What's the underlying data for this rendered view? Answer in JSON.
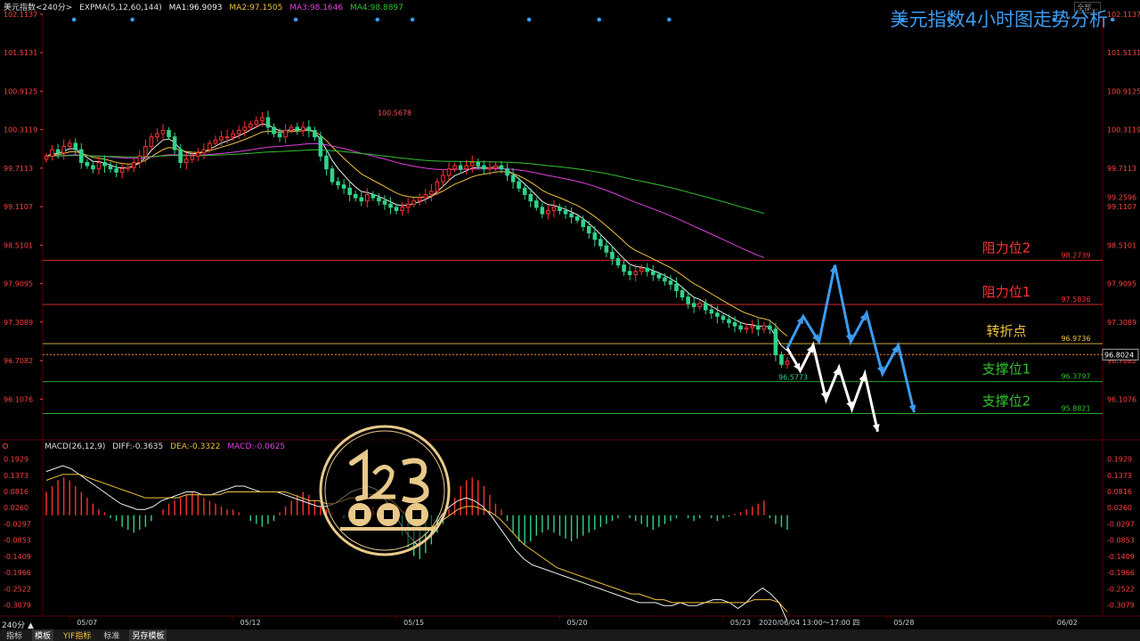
{
  "header": {
    "symbol": "美元指数<240分>",
    "indicator": "EXPMA(5,12,60,144)",
    "ma1": "MA1:96.9093",
    "ma2": "MA2:97.1505",
    "ma3": "MA3:98.1646",
    "ma4": "MA4:98.8897"
  },
  "title": "美元指数4小时图走势分析",
  "top_right_label": "全部...",
  "macd_header": {
    "name": "MACD(26,12,9)",
    "diff": "DIFF:-0.3635",
    "dea": "DEA:-0.3322",
    "macd": "MACD:-0.0625"
  },
  "period_label": "240分 ▲",
  "date_info": "2020/06/04 13:00～17:00 四",
  "bottom_tabs": [
    "指标",
    "模板",
    "YIF指标",
    "标准",
    "另存模板"
  ],
  "colors": {
    "up": "#ff3030",
    "down": "#2fd38a",
    "ma1": "#f0f0f0",
    "ma2": "#f0c040",
    "ma3": "#e040e0",
    "ma4": "#30c030",
    "blue": "#3b9cf0",
    "resist": "#ff3030",
    "turn": "#f0c040",
    "support": "#30c030",
    "grid": "#330000"
  },
  "chart_data": [
    {
      "type": "line",
      "name": "candlestick",
      "yticks": [
        "102.1137",
        "101.5131",
        "100.9125",
        "100.3119",
        "99.7113",
        "99.1107",
        "98.5101",
        "97.9095",
        "97.3089",
        "96.7082",
        "96.1076"
      ],
      "ylim": [
        95.5,
        102.1137
      ],
      "xticks": [
        {
          "label": "05/07",
          "i": 4
        },
        {
          "label": "05/12",
          "i": 32
        },
        {
          "label": "05/15",
          "i": 60
        },
        {
          "label": "05/20",
          "i": 88
        },
        {
          "label": "05/23",
          "i": 116
        },
        {
          "label": "05/28",
          "i": 144
        },
        {
          "label": "06/02",
          "i": 172
        }
      ],
      "high_label": {
        "text": "100.5678",
        "i": 58,
        "value": 100.5678
      },
      "low_label": {
        "text": "96.5773",
        "i": 206,
        "value": 96.5773
      },
      "current_price": "96.8024",
      "current_value": 96.8024,
      "levels": [
        {
          "name": "阻力位2",
          "value": 98.2739,
          "label": "98.2739",
          "kind": "resist"
        },
        {
          "name": "阻力位1",
          "value": 97.5836,
          "label": "97.5836",
          "kind": "resist"
        },
        {
          "name": "转折点",
          "value": 96.9736,
          "label": "96.9736",
          "kind": "turn"
        },
        {
          "name": "支撑位1",
          "value": 96.3797,
          "label": "96.3797",
          "kind": "support"
        },
        {
          "name": "支撑位2",
          "value": 95.8821,
          "label": "95.8821",
          "kind": "support"
        }
      ],
      "right_side_label": {
        "text": "99.2596",
        "value": 99.2596
      },
      "closes": [
        99.9,
        100.0,
        99.95,
        100.05,
        100.1,
        100.0,
        99.8,
        99.75,
        99.7,
        99.8,
        99.75,
        99.7,
        99.65,
        99.7,
        99.72,
        99.8,
        99.9,
        100.05,
        100.2,
        100.25,
        100.3,
        100.2,
        100.0,
        99.8,
        99.85,
        99.9,
        99.95,
        100.0,
        100.1,
        100.15,
        100.2,
        100.2,
        100.25,
        100.3,
        100.35,
        100.4,
        100.45,
        100.5,
        100.35,
        100.25,
        100.2,
        100.3,
        100.35,
        100.3,
        100.35,
        100.3,
        100.2,
        99.9,
        99.7,
        99.5,
        99.45,
        99.4,
        99.3,
        99.25,
        99.2,
        99.3,
        99.25,
        99.2,
        99.15,
        99.1,
        99.05,
        99.1,
        99.15,
        99.2,
        99.25,
        99.3,
        99.35,
        99.5,
        99.6,
        99.7,
        99.75,
        99.7,
        99.75,
        99.8,
        99.75,
        99.7,
        99.72,
        99.75,
        99.7,
        99.6,
        99.5,
        99.4,
        99.3,
        99.2,
        99.1,
        99.0,
        99.05,
        99.1,
        99.05,
        99.0,
        98.95,
        98.9,
        98.8,
        98.7,
        98.6,
        98.5,
        98.4,
        98.3,
        98.2,
        98.1,
        98.05,
        98.1,
        98.15,
        98.1,
        98.05,
        98.0,
        97.95,
        97.9,
        97.8,
        97.7,
        97.6,
        97.55,
        97.6,
        97.5,
        97.45,
        97.4,
        97.35,
        97.3,
        97.25,
        97.2,
        97.22,
        97.25,
        97.2,
        97.25,
        97.2,
        96.8,
        96.65,
        96.7
      ],
      "series_ma": [
        {
          "name": "MA1",
          "values_from": "closes",
          "period": 5
        },
        {
          "name": "MA2",
          "values_from": "closes",
          "period": 12
        },
        {
          "name": "MA3",
          "values_from": "closes",
          "period": 60
        },
        {
          "name": "MA4",
          "values_from": "closes",
          "period": 144
        }
      ],
      "projection_blue": [
        [
          96.9,
          0
        ],
        [
          97.4,
          1
        ],
        [
          97.0,
          2
        ],
        [
          98.2,
          3
        ],
        [
          97.0,
          4
        ],
        [
          97.45,
          5
        ],
        [
          96.5,
          6
        ],
        [
          96.95,
          7
        ],
        [
          95.9,
          8
        ]
      ],
      "projection_white": [
        [
          96.9,
          0
        ],
        [
          96.55,
          1
        ],
        [
          96.95,
          2
        ],
        [
          96.1,
          3
        ],
        [
          96.6,
          4
        ],
        [
          95.95,
          5
        ],
        [
          96.5,
          6
        ],
        [
          95.6,
          7
        ]
      ]
    },
    {
      "type": "bar",
      "name": "MACD",
      "yticks": [
        "0.1929",
        "0.1373",
        "0.0816",
        "0.0260",
        "-0.0297",
        "-0.0853",
        "-0.1409",
        "-0.1966",
        "-0.2522",
        "-0.3079"
      ],
      "ylim": [
        -0.34,
        0.21
      ],
      "histogram": [
        0.08,
        0.1,
        0.12,
        0.13,
        0.12,
        0.1,
        0.08,
        0.06,
        0.04,
        0.02,
        0.01,
        -0.01,
        -0.02,
        -0.04,
        -0.05,
        -0.06,
        -0.05,
        -0.04,
        -0.02,
        0.0,
        0.02,
        0.04,
        0.05,
        0.06,
        0.07,
        0.08,
        0.07,
        0.06,
        0.05,
        0.04,
        0.03,
        0.02,
        0.02,
        0.01,
        0.0,
        -0.02,
        -0.03,
        -0.04,
        -0.03,
        -0.02,
        0.01,
        0.03,
        0.05,
        0.07,
        0.08,
        0.07,
        0.05,
        0.03,
        0.02,
        0.01,
        0.0,
        -0.01,
        -0.02,
        0.0,
        0.01,
        0.02,
        0.03,
        0.02,
        0.01,
        0.0,
        -0.03,
        -0.07,
        -0.11,
        -0.14,
        -0.15,
        -0.13,
        -0.1,
        -0.06,
        -0.03,
        0.02,
        0.06,
        0.1,
        0.12,
        0.13,
        0.12,
        0.1,
        0.07,
        0.04,
        0.02,
        -0.02,
        -0.06,
        -0.09,
        -0.1,
        -0.09,
        -0.07,
        -0.06,
        -0.05,
        -0.06,
        -0.07,
        -0.08,
        -0.09,
        -0.08,
        -0.07,
        -0.06,
        -0.05,
        -0.04,
        -0.03,
        -0.02,
        -0.01,
        0.0,
        -0.01,
        -0.02,
        -0.03,
        -0.04,
        -0.05,
        -0.04,
        -0.03,
        -0.02,
        -0.01,
        0.0,
        -0.01,
        -0.02,
        -0.01,
        0.0,
        -0.01,
        -0.02,
        -0.01,
        -0.005,
        0.005,
        0.01,
        0.02,
        0.03,
        0.04,
        0.05,
        -0.01,
        -0.03,
        -0.04,
        -0.05
      ],
      "diff": [
        0.15,
        0.16,
        0.17,
        0.16,
        0.14,
        0.12,
        0.1,
        0.08,
        0.06,
        0.04,
        0.03,
        0.02,
        0.02,
        0.03,
        0.05,
        0.06,
        0.07,
        0.08,
        0.08,
        0.07,
        0.07,
        0.08,
        0.09,
        0.1,
        0.1,
        0.09,
        0.08,
        0.08,
        0.08,
        0.07,
        0.06,
        0.05,
        0.04,
        0.03,
        0.03,
        0.04,
        0.06,
        0.08,
        0.09,
        0.1,
        0.09,
        0.06,
        0.02,
        -0.03,
        -0.07,
        -0.1,
        -0.09,
        -0.05,
        0.0,
        0.03,
        0.05,
        0.06,
        0.05,
        0.03,
        0.0,
        -0.04,
        -0.08,
        -0.12,
        -0.15,
        -0.17,
        -0.18,
        -0.19,
        -0.2,
        -0.21,
        -0.22,
        -0.23,
        -0.24,
        -0.25,
        -0.26,
        -0.27,
        -0.28,
        -0.29,
        -0.3,
        -0.3,
        -0.3,
        -0.31,
        -0.31,
        -0.3,
        -0.31,
        -0.31,
        -0.3,
        -0.29,
        -0.29,
        -0.3,
        -0.32,
        -0.3,
        -0.27,
        -0.25,
        -0.27,
        -0.3,
        -0.3635
      ],
      "dea": [
        0.12,
        0.13,
        0.14,
        0.14,
        0.14,
        0.13,
        0.12,
        0.11,
        0.1,
        0.09,
        0.08,
        0.07,
        0.06,
        0.06,
        0.06,
        0.06,
        0.06,
        0.07,
        0.07,
        0.07,
        0.07,
        0.07,
        0.08,
        0.08,
        0.08,
        0.08,
        0.08,
        0.08,
        0.08,
        0.08,
        0.07,
        0.06,
        0.05,
        0.05,
        0.04,
        0.04,
        0.05,
        0.06,
        0.06,
        0.07,
        0.07,
        0.06,
        0.05,
        0.02,
        -0.01,
        -0.04,
        -0.05,
        -0.04,
        -0.02,
        0.0,
        0.02,
        0.03,
        0.03,
        0.02,
        0.01,
        -0.01,
        -0.04,
        -0.07,
        -0.1,
        -0.12,
        -0.14,
        -0.16,
        -0.18,
        -0.19,
        -0.2,
        -0.21,
        -0.22,
        -0.23,
        -0.24,
        -0.25,
        -0.26,
        -0.27,
        -0.27,
        -0.28,
        -0.29,
        -0.29,
        -0.3,
        -0.3,
        -0.3,
        -0.3,
        -0.3,
        -0.3,
        -0.3,
        -0.3,
        -0.3,
        -0.3,
        -0.29,
        -0.29,
        -0.29,
        -0.3,
        -0.3322
      ]
    }
  ]
}
